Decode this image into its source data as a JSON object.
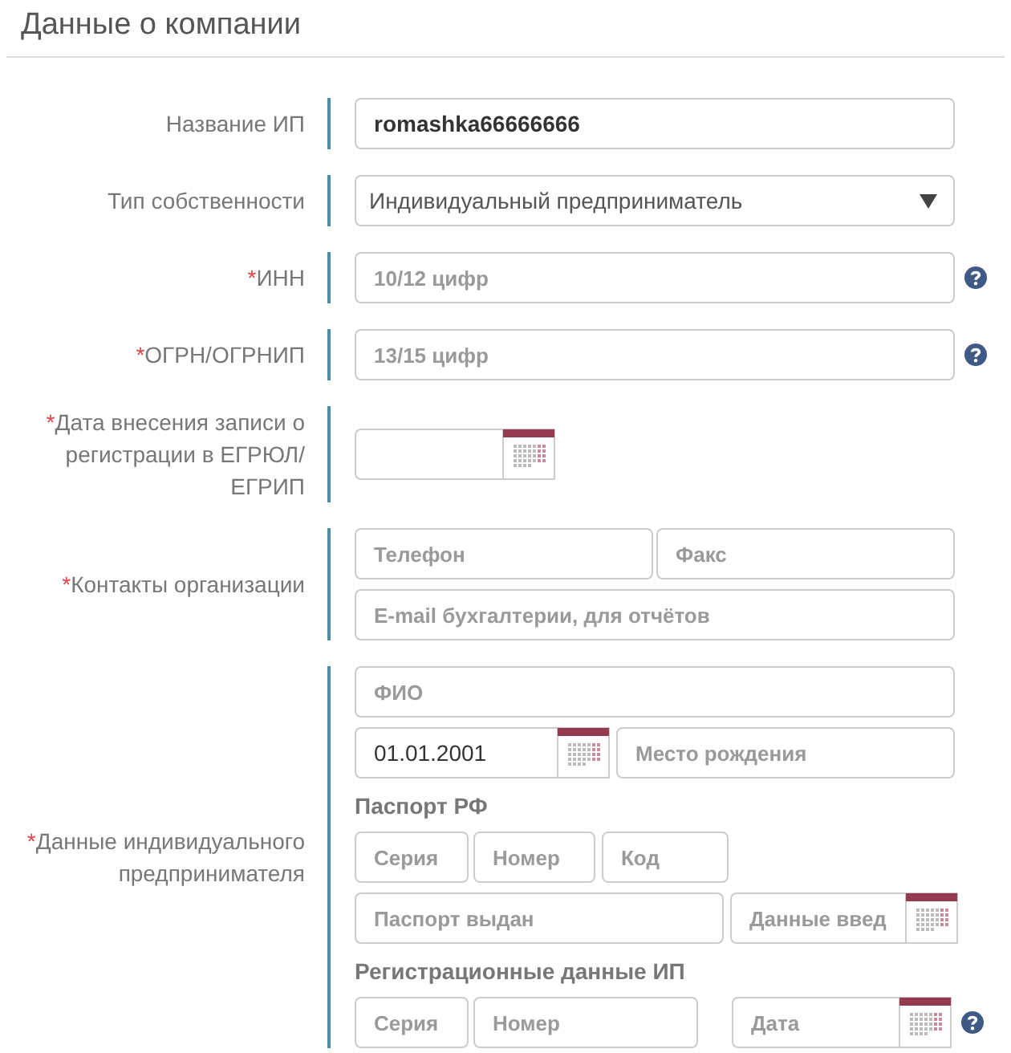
{
  "section_title": "Данные о компании",
  "rows": [
    {
      "label": "Название ИП",
      "lines": [
        {
          "kind": "fields",
          "fields": [
            {
              "kind": "text",
              "value": "romashka66666666"
            }
          ]
        }
      ]
    },
    {
      "label": "Тип собственности",
      "lines": [
        {
          "kind": "fields",
          "fields": [
            {
              "kind": "select",
              "value": "Индивидуальный предприниматель"
            }
          ]
        }
      ]
    },
    {
      "label": "ИНН",
      "required_mark": "*",
      "lines": [
        {
          "kind": "fields",
          "help": true,
          "fields": [
            {
              "kind": "text",
              "placeholder": "10/12 цифр"
            }
          ]
        }
      ]
    },
    {
      "label": "ОГРН/ОГРНИП",
      "required_mark": "*",
      "lines": [
        {
          "kind": "fields",
          "help": true,
          "fields": [
            {
              "kind": "text",
              "placeholder": "13/15 цифр"
            }
          ]
        }
      ]
    },
    {
      "label": "Дата внесения записи о регистрации в ЕГРЮЛ/ ЕГРИП",
      "required_mark": "*",
      "lines": [
        {
          "kind": "fields",
          "fields": [
            {
              "kind": "date"
            }
          ]
        }
      ]
    },
    {
      "label": "Контакты организации",
      "required_mark": "*",
      "lines": [
        {
          "kind": "fields",
          "fields": [
            {
              "kind": "text",
              "placeholder": "Телефон"
            },
            {
              "kind": "text",
              "placeholder": "Факс"
            }
          ]
        },
        {
          "kind": "fields",
          "fields": [
            {
              "kind": "text",
              "placeholder": "E-mail бухгалтерии, для отчётов"
            }
          ]
        }
      ]
    },
    {
      "label": "Данные индивидуального предпринимателя",
      "required_mark": "*",
      "lines": [
        {
          "kind": "fields",
          "fields": [
            {
              "kind": "text",
              "placeholder": "ФИО"
            }
          ]
        },
        {
          "kind": "fields",
          "fields": [
            {
              "kind": "date",
              "value": "01.01.2001"
            },
            {
              "kind": "text",
              "placeholder": "Место рождения"
            }
          ]
        },
        {
          "kind": "heading",
          "text": "Паспорт РФ"
        },
        {
          "kind": "fields",
          "fields": [
            {
              "kind": "text",
              "placeholder": "Серия"
            },
            {
              "kind": "text",
              "placeholder": "Номер"
            },
            {
              "kind": "text",
              "placeholder": "Код"
            }
          ]
        },
        {
          "kind": "fields",
          "fields": [
            {
              "kind": "text",
              "placeholder": "Паспорт выдан"
            },
            {
              "kind": "date",
              "placeholder": "Данные введ"
            }
          ]
        },
        {
          "kind": "heading",
          "text": "Регистрационные данные ИП"
        },
        {
          "kind": "fields",
          "help": true,
          "fields": [
            {
              "kind": "text",
              "placeholder": "Серия"
            },
            {
              "kind": "text",
              "placeholder": "Номер"
            },
            {
              "kind": "date",
              "placeholder": "Дата"
            }
          ]
        }
      ]
    }
  ]
}
